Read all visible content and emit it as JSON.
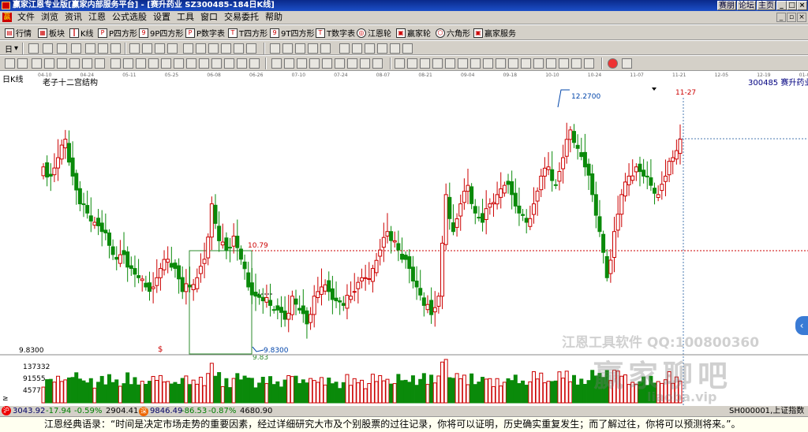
{
  "window": {
    "title": "赢家江恩专业版[赢家内部服务平台] - [赛升药业  SZ300485-184日K线]",
    "links": [
      "赛朋",
      "论坛",
      "主页"
    ]
  },
  "menu": [
    "文件",
    "浏览",
    "资讯",
    "江恩",
    "公式选股",
    "设置",
    "工具",
    "窗口",
    "交易委托",
    "帮助"
  ],
  "toolbar1": [
    "行情",
    "板块",
    "K线",
    "P四方形",
    "9P四方形",
    "P数字表",
    "T四方形",
    "9T四方形",
    "T数字表",
    "江恩轮",
    "赢家轮",
    "六角形",
    "赢家服务"
  ],
  "toolbar2": {
    "period": "日"
  },
  "chart": {
    "period_label": "日K线",
    "study_label": "老子十二宫结构",
    "code_name": "300485  赛升药业",
    "high_label": "12.2700",
    "low_label": "9.8300",
    "resistance_label": "10.79",
    "box_bottom_label": "9.83",
    "last_date_label": "11-27",
    "axis_low": "9.8300",
    "date_ticks": [
      "04-10",
      "04-24",
      "05-11",
      "05-25",
      "06-08",
      "06-26",
      "07-10",
      "07-24",
      "08-07",
      "08-21",
      "09-04",
      "09-18",
      "10-10",
      "10-24",
      "11-07",
      "11-21",
      "12-05",
      "12-19",
      "01-02"
    ],
    "volume_axis": [
      "137332",
      "91555",
      "45777"
    ],
    "volume_corner": "≥"
  },
  "watermark": {
    "line1": "江恩工具软件  QQ:100800360",
    "logo": "赢家聊吧",
    "sub": "liaoba.vip"
  },
  "chart_data": {
    "type": "candlestick",
    "title": "老子十二宫结构",
    "symbol": "300485 赛升药业",
    "period": "日K线",
    "x_ticks": [
      "04-10",
      "04-24",
      "05-11",
      "05-25",
      "06-08",
      "06-26",
      "07-10",
      "07-24",
      "08-07",
      "08-21",
      "09-04",
      "09-18",
      "10-10",
      "10-24",
      "11-07",
      "11-21",
      "12-05",
      "12-19",
      "01-02"
    ],
    "price_range": [
      9.6,
      12.4
    ],
    "marked_high": 12.27,
    "marked_low": 9.83,
    "resistance_line": 10.79,
    "volume_axis_ticks": [
      45777,
      91555,
      137332
    ],
    "close_anchor": [
      11.6,
      11.5,
      11.7,
      11.9,
      11.5,
      11.2,
      11.1,
      11.0,
      10.9,
      10.75,
      10.6,
      10.65,
      10.5,
      10.4,
      10.3,
      10.3,
      10.5,
      10.6,
      10.5,
      10.25,
      10.3,
      10.4,
      10.6,
      11.2,
      10.8,
      10.7,
      10.85,
      10.6,
      10.3,
      10.2,
      10.15,
      10.1,
      10.05,
      9.95,
      10.2,
      10.05,
      9.9,
      10.2,
      10.3,
      10.25,
      10.15,
      10.1,
      10.2,
      10.35,
      10.4,
      10.5,
      10.7,
      10.9,
      10.8,
      10.6,
      10.5,
      10.3,
      10.1,
      10.0,
      10.2,
      11.3,
      10.9,
      11.2,
      11.4,
      11.1,
      11.0,
      11.2,
      11.3,
      11.4,
      11.3,
      11.1,
      11.0,
      11.2,
      11.5,
      11.6,
      11.4,
      11.7,
      12.0,
      11.8,
      11.6,
      11.3,
      10.9,
      10.4,
      10.9,
      11.3,
      11.5,
      11.6,
      11.5,
      11.4,
      11.3,
      11.5,
      11.7,
      11.9
    ]
  },
  "status": {
    "sh_index": "3043.92",
    "sh_change": "-17.94",
    "sh_pct": "-0.59%",
    "sh_amount": "2904.41",
    "sz_index": "9846.49",
    "sz_change": "-86.53",
    "sz_pct": "-0.87%",
    "sz_amount": "4680.90",
    "right_label": "SH000001,上证指数"
  },
  "quote": "江恩经典语录：“时间是决定市场走势的重要因素，经过详细研究大市及个别股票的过往记录，你将可以证明，历史确实重复发生；而了解过往，你将可以预测将来。”。",
  "colors": {
    "up": "#cc0000",
    "down": "#0a8a0a",
    "titlebar": "#0a2a8a"
  }
}
